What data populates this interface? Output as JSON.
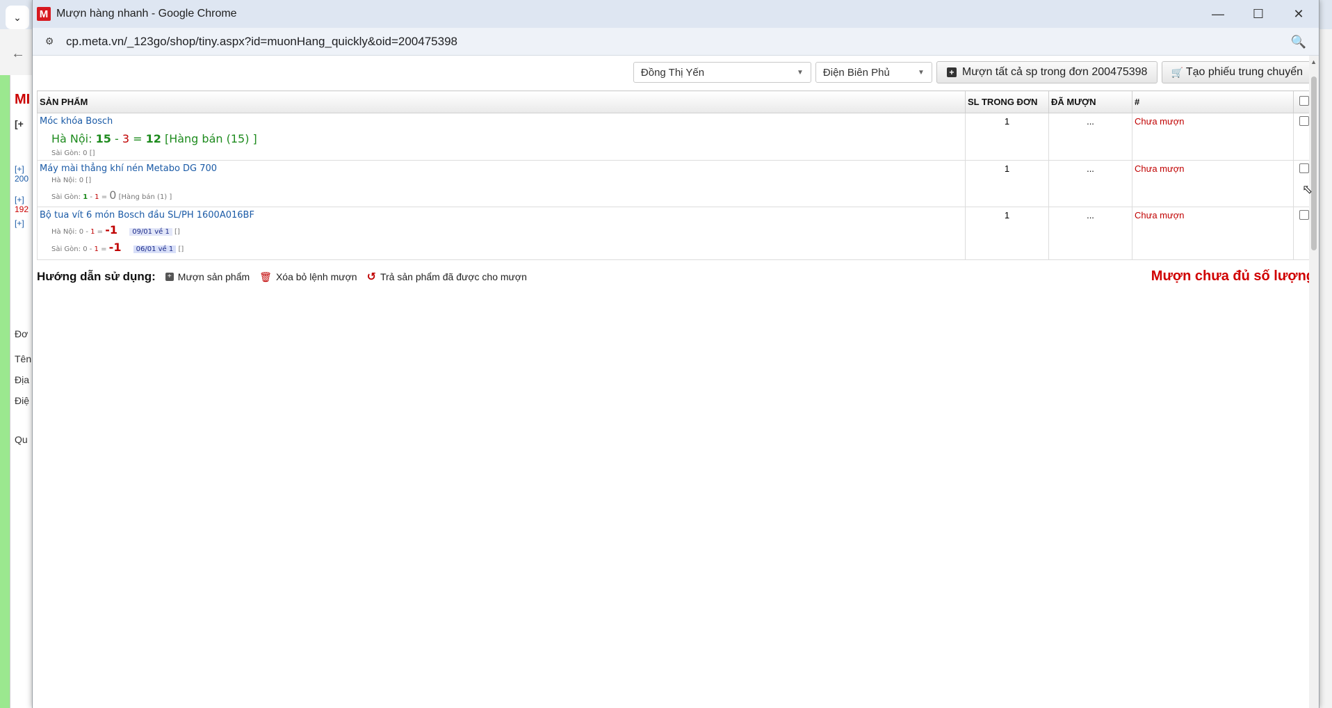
{
  "window": {
    "title": "Mượn hàng nhanh - Google Chrome",
    "logo_letter": "M",
    "url": "cp.meta.vn/_123go/shop/tiny.aspx?id=muonHang_quickly&oid=200475398"
  },
  "background": {
    "strip_texts": [
      "MI",
      "[+",
      "[+]",
      "200",
      "[+]",
      "192",
      "[+]",
      "Đơ",
      "Tên",
      "Địa",
      "Điệ",
      "Qu"
    ]
  },
  "toolbar": {
    "select_employee": "Đồng Thị Yến",
    "select_branch": "Điện Biên Phủ",
    "borrow_all_label": "Mượn tất cả sp trong đơn 200475398",
    "transfer_label": "Tạo phiếu trung chuyển"
  },
  "table": {
    "headers": {
      "product": "SẢN PHẨM",
      "qty_in_order": "SL TRONG ĐƠN",
      "borrowed": "ĐÃ MƯỢN",
      "status": "#"
    },
    "rows": [
      {
        "name": "Móc khóa Bosch",
        "hn_label": "Hà Nội:",
        "hn_a": "15",
        "hn_b": "3",
        "hn_result": "12",
        "hn_note": "[Hàng bán (15) ]",
        "sg_line": "Sài Gòn: 0 []",
        "qty": "1",
        "borrowed": "...",
        "status": "Chưa mượn"
      },
      {
        "name": "Máy mài thẳng khí nén Metabo DG 700",
        "hn_line": "Hà Nội: 0 []",
        "sg_label": "Sài Gòn:",
        "sg_a": "1",
        "sg_b": "1",
        "sg_result": "0",
        "sg_note": "[Hàng bán (1) ]",
        "qty": "1",
        "borrowed": "...",
        "status": "Chưa mượn"
      },
      {
        "name": "Bộ tua vít 6 món Bosch đầu SL/PH 1600A016BF",
        "hn_label": "Hà Nội:",
        "hn_a": "0",
        "hn_b": "1",
        "hn_result": "-1",
        "hn_tag": "09/01 về 1",
        "hn_tail": "[]",
        "sg_label": "Sài Gòn:",
        "sg_a": "0",
        "sg_b": "1",
        "sg_result": "-1",
        "sg_tag": "06/01 về 1",
        "sg_tail": "[]",
        "qty": "1",
        "borrowed": "...",
        "status": "Chưa mượn"
      }
    ]
  },
  "guide": {
    "title": "Hướng dẫn sử dụng:",
    "borrow": "Mượn sản phẩm",
    "delete": "Xóa bỏ lệnh mượn",
    "return": "Trả sản phẩm đã được cho mượn",
    "warning": "Mượn chưa đủ số lượng"
  },
  "icons": {
    "minimize": "minimize-icon",
    "maximize": "maximize-icon",
    "close": "close-icon",
    "zoom": "zoom-icon",
    "site_info": "site-info-icon"
  },
  "colors": {
    "status_red": "#c00000",
    "stock_green": "#1e8b1e",
    "link_blue": "#1a5aa6",
    "warning_red": "#d00000"
  }
}
